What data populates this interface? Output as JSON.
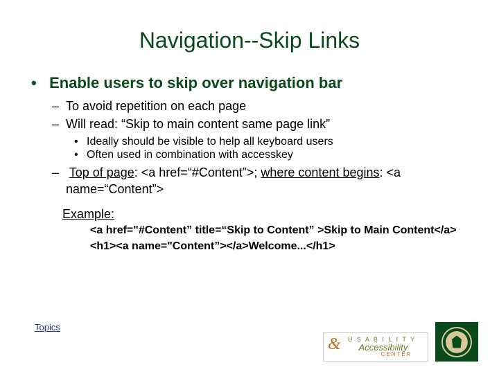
{
  "title": "Navigation--Skip Links",
  "bullet1": "Enable users to skip over navigation bar",
  "sub1": "To avoid repetition on each page",
  "sub2": "Will read: “Skip to main content same page link”",
  "subsub1": "Ideally should be visible to help all keyboard users",
  "subsub2": "Often used in combination with accesskey",
  "sub3_a": "Top of page",
  "sub3_b": ": <a href=“#Content”>; ",
  "sub3_c": "where content begins",
  "sub3_d": ": <a name=“Content”>",
  "example_label": "Example:",
  "code1": "<a href=\"#Content” title=“Skip to Content” >Skip to Main Content</a>",
  "code2": "<h1><a name=\"Content”></a>Welcome...</h1>",
  "topics": "Topics",
  "logo_ua_line1": "U S A B I L I T Y",
  "logo_ua_line2": "Accessibility",
  "logo_ua_line3": "CENTER"
}
